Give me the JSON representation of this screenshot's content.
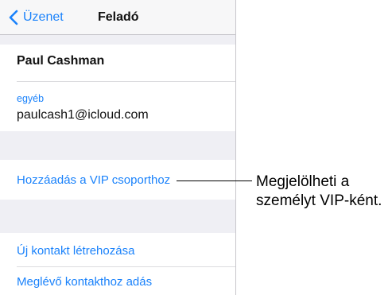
{
  "navbar": {
    "back_label": "Üzenet",
    "title": "Feladó"
  },
  "contact": {
    "name": "Paul Cashman",
    "email_label": "egyéb",
    "email": "paulcash1@icloud.com"
  },
  "actions": {
    "add_vip": "Hozzáadás a VIP csoporthoz",
    "new_contact": "Új kontakt létrehozása",
    "add_existing": "Meglévő kontakthoz adás"
  },
  "callout": {
    "line1": "Megjelölheti a",
    "line2": "személyt VIP-ként."
  },
  "colors": {
    "accent": "#1a82fb",
    "background": "#efeff4"
  }
}
